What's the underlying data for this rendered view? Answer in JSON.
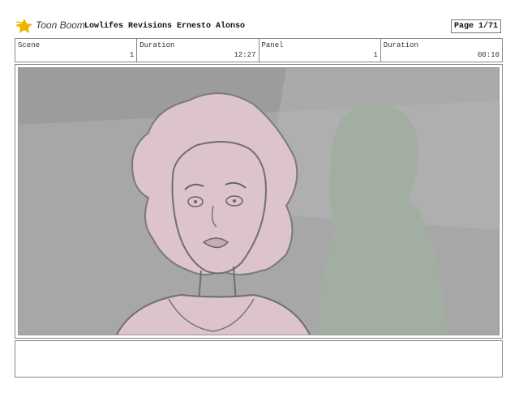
{
  "header": {
    "logo_text": "Toon Boom",
    "project_title": "Lowlifes Revisions Ernesto Alonso",
    "page_label": "Page",
    "page_value": "1/71",
    "accent_color": "#f0b400"
  },
  "info": {
    "scene_label": "Scene",
    "scene_value": "1",
    "scene_duration_label": "Duration",
    "scene_duration_value": "12:27",
    "panel_label": "Panel",
    "panel_value": "1",
    "panel_duration_label": "Duration",
    "panel_duration_value": "00:10"
  },
  "panel_image": {
    "skin_color": "#dcc3cc",
    "background_color": "#a7a7a7",
    "figure_color": "#a3aea3"
  },
  "notes": {
    "text": ""
  }
}
